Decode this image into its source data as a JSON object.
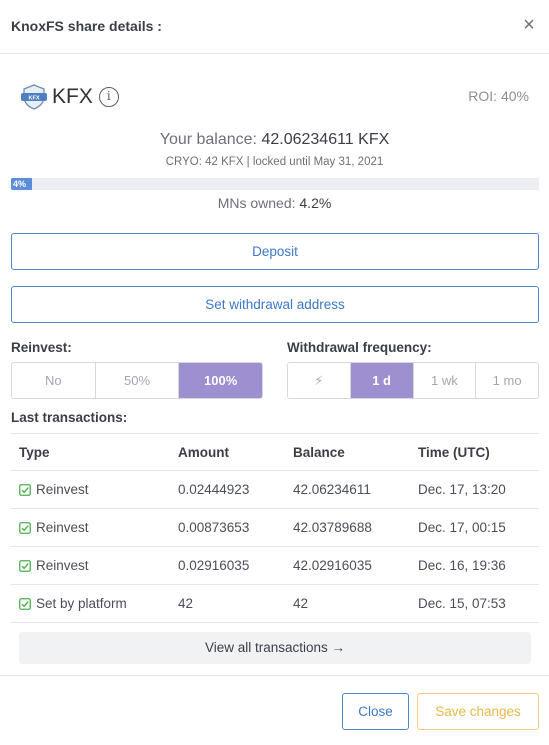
{
  "header": {
    "title": "KnoxFS share details :",
    "close_glyph": "×"
  },
  "asset": {
    "logo_text": "KFX",
    "name": "KFX",
    "info_glyph": "i",
    "roi": "ROI: 40%"
  },
  "balance": {
    "label": "Your balance:",
    "value": "42.06234611 KFX",
    "cryo": "CRYO: 42 KFX | locked until May 31, 2021"
  },
  "progress": {
    "percent": 4,
    "label": "4%"
  },
  "mns": {
    "label": "MNs owned:",
    "value": "4.2%"
  },
  "actions": {
    "deposit": "Deposit",
    "set_withdrawal": "Set withdrawal address"
  },
  "reinvest": {
    "label": "Reinvest:",
    "options": [
      "No",
      "50%",
      "100%"
    ],
    "selected": "100%"
  },
  "withdrawal_frequency": {
    "label": "Withdrawal frequency:",
    "options": [
      {
        "label": "⚡",
        "icon": "lightning-icon"
      },
      {
        "label": "1 d"
      },
      {
        "label": "1 wk"
      },
      {
        "label": "1 mo"
      }
    ],
    "selected": "1 d"
  },
  "transactions": {
    "label": "Last transactions:",
    "columns": [
      "Type",
      "Amount",
      "Balance",
      "Time (UTC)"
    ],
    "rows": [
      {
        "type": "Reinvest",
        "amount": "0.02444923",
        "balance": "42.06234611",
        "time": "Dec. 17, 13:20"
      },
      {
        "type": "Reinvest",
        "amount": "0.00873653",
        "balance": "42.03789688",
        "time": "Dec. 17, 00:15"
      },
      {
        "type": "Reinvest",
        "amount": "0.02916035",
        "balance": "42.02916035",
        "time": "Dec. 16, 19:36"
      },
      {
        "type": "Set by platform",
        "amount": "42",
        "balance": "42",
        "time": "Dec. 15, 07:53"
      }
    ],
    "view_all": "View all transactions →"
  },
  "footer": {
    "close": "Close",
    "save": "Save changes"
  },
  "colors": {
    "accent": "#4a86d4",
    "selected": "#9d8fd0",
    "save": "#e9b84b",
    "check": "#4caf50",
    "progress": "#5b8ed6"
  }
}
